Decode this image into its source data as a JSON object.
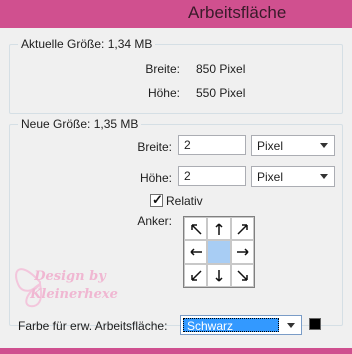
{
  "window": {
    "title": "Arbeitsfläche"
  },
  "current_size": {
    "legend": "Aktuelle Größe: 1,34 MB",
    "width_label": "Breite:",
    "width_value": "850 Pixel",
    "height_label": "Höhe:",
    "height_value": "550 Pixel"
  },
  "new_size": {
    "legend": "Neue Größe: 1,35 MB",
    "width_label": "Breite:",
    "width_value": "2",
    "width_unit": "Pixel",
    "height_label": "Höhe:",
    "height_value": "2",
    "height_unit": "Pixel",
    "relative_label": "Relativ",
    "relative_checked": true,
    "anchor_label": "Anker:"
  },
  "extension_color": {
    "label": "Farbe für erw. Arbeitsfläche:",
    "value": "Schwarz",
    "swatch_color": "#000000"
  },
  "watermark": {
    "text_line1": "Design by",
    "text_line2": "Kleinerhexe"
  }
}
